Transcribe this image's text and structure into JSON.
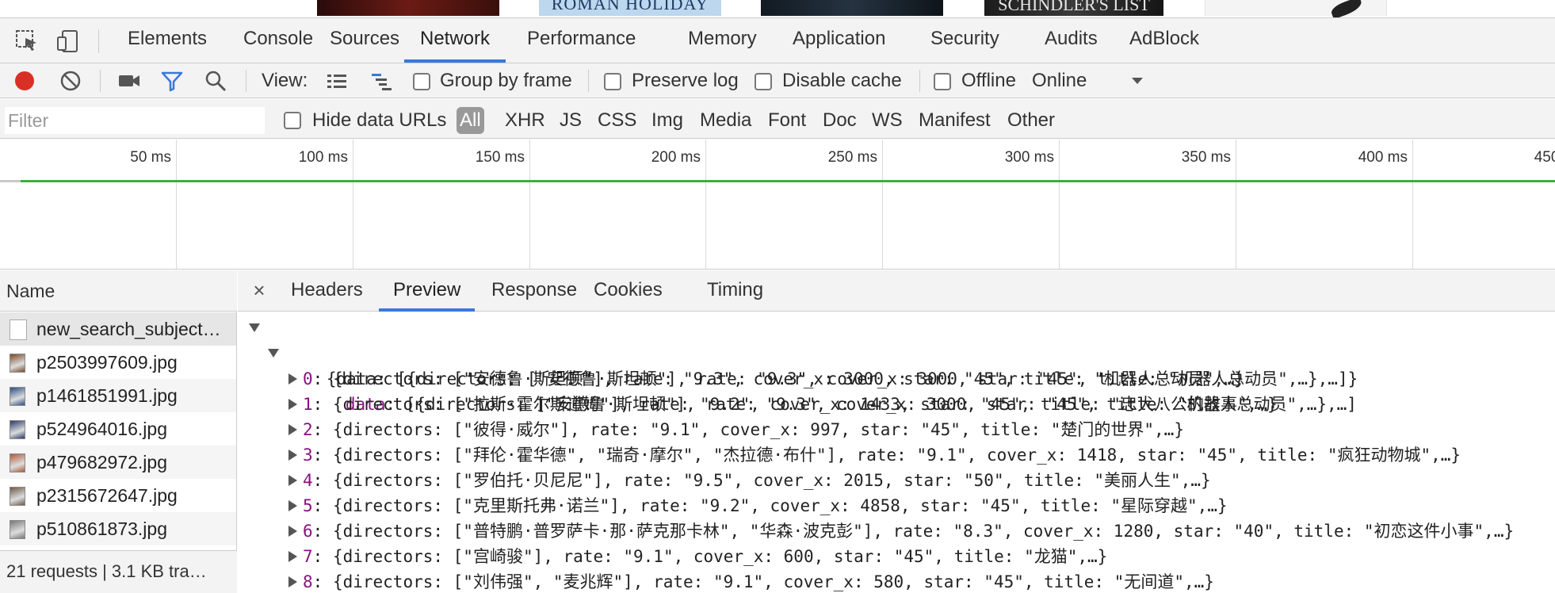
{
  "page_strip": {
    "thumb2_text": "ROMAN HOLIDAY",
    "thumb4_text": "SCHINDLER'S LIST"
  },
  "devtools_tabs": [
    "Elements",
    "Console",
    "Sources",
    "Network",
    "Performance",
    "Memory",
    "Application",
    "Security",
    "Audits",
    "AdBlock"
  ],
  "active_tab": "Network",
  "toolbar": {
    "view_label": "View:",
    "group_by_frame": "Group by frame",
    "preserve_log": "Preserve log",
    "disable_cache": "Disable cache",
    "offline": "Offline",
    "throttle": "Online"
  },
  "filter": {
    "placeholder": "Filter",
    "hide_data_urls": "Hide data URLs",
    "types": [
      "All",
      "XHR",
      "JS",
      "CSS",
      "Img",
      "Media",
      "Font",
      "Doc",
      "WS",
      "Manifest",
      "Other"
    ],
    "active_type": "All"
  },
  "timeline": {
    "ticks": [
      "50 ms",
      "100 ms",
      "150 ms",
      "200 ms",
      "250 ms",
      "300 ms",
      "350 ms",
      "400 ms",
      "450 ms"
    ]
  },
  "name_panel": {
    "header": "Name",
    "rows": [
      {
        "name": "new_search_subjects?sort=T",
        "display": "new_search_subject…",
        "kind": "doc"
      },
      {
        "name": "p2503997609.jpg",
        "display": "p2503997609.jpg",
        "kind": "img",
        "color": "#7a4a2a"
      },
      {
        "name": "p1461851991.jpg",
        "display": "p1461851991.jpg",
        "kind": "img",
        "color": "#2c4f86"
      },
      {
        "name": "p524964016.jpg",
        "display": "p524964016.jpg",
        "kind": "img",
        "color": "#2a3b66"
      },
      {
        "name": "p479682972.jpg",
        "display": "p479682972.jpg",
        "kind": "img",
        "color": "#b05a3c"
      },
      {
        "name": "p2315672647.jpg",
        "display": "p2315672647.jpg",
        "kind": "img",
        "color": "#6d5a48"
      },
      {
        "name": "p510861873.jpg",
        "display": "p510861873.jpg",
        "kind": "img",
        "color": "#777777"
      }
    ],
    "summary": "21 requests | 3.1 KB tra…"
  },
  "detail_tabs": [
    "Headers",
    "Preview",
    "Response",
    "Cookies",
    "Timing"
  ],
  "active_detail_tab": "Preview",
  "preview": {
    "root": "{data: [{directors: [\"安德鲁·斯坦顿\"], rate: \"9.3\", cover_x: 3000, star: \"45\", title: \"机器人总动员\",…},…]}",
    "data_key": "data",
    "data_summary": ": [{directors: [\"安德鲁·斯坦顿\"], rate: \"9.3\", cover_x: 3000, star: \"45\", title: \"机器人总动员\",…},…]",
    "items": [
      {
        "index": "0",
        "text": ": {directors: [\"安德鲁·斯坦顿\"], rate: \"9.3\", cover_x: 3000, star: \"45\", title: \"机器人总动员\",…}"
      },
      {
        "index": "1",
        "text": ": {directors: [\"拉斯·霍尔斯道姆\"], rate: \"9.2\", cover_x: 1433, star: \"45\", title: \"忠犬八公的故事\",…}"
      },
      {
        "index": "2",
        "text": ": {directors: [\"彼得·威尔\"], rate: \"9.1\", cover_x: 997, star: \"45\", title: \"楚门的世界\",…}"
      },
      {
        "index": "3",
        "text": ": {directors: [\"拜伦·霍华德\", \"瑞奇·摩尔\", \"杰拉德·布什\"], rate: \"9.1\", cover_x: 1418, star: \"45\", title: \"疯狂动物城\",…}"
      },
      {
        "index": "4",
        "text": ": {directors: [\"罗伯托·贝尼尼\"], rate: \"9.5\", cover_x: 2015, star: \"50\", title: \"美丽人生\",…}"
      },
      {
        "index": "5",
        "text": ": {directors: [\"克里斯托弗·诺兰\"], rate: \"9.2\", cover_x: 4858, star: \"45\", title: \"星际穿越\",…}"
      },
      {
        "index": "6",
        "text": ": {directors: [\"普特鹏·普罗萨卡·那·萨克那卡林\", \"华森·波克彭\"], rate: \"8.3\", cover_x: 1280, star: \"40\", title: \"初恋这件小事\",…}"
      },
      {
        "index": "7",
        "text": ": {directors: [\"宫崎骏\"], rate: \"9.1\", cover_x: 600, star: \"45\", title: \"龙猫\",…}"
      },
      {
        "index": "8",
        "text": ": {directors: [\"刘伟强\", \"麦兆辉\"], rate: \"9.1\", cover_x: 580, star: \"45\", title: \"无间道\",…}"
      }
    ]
  }
}
